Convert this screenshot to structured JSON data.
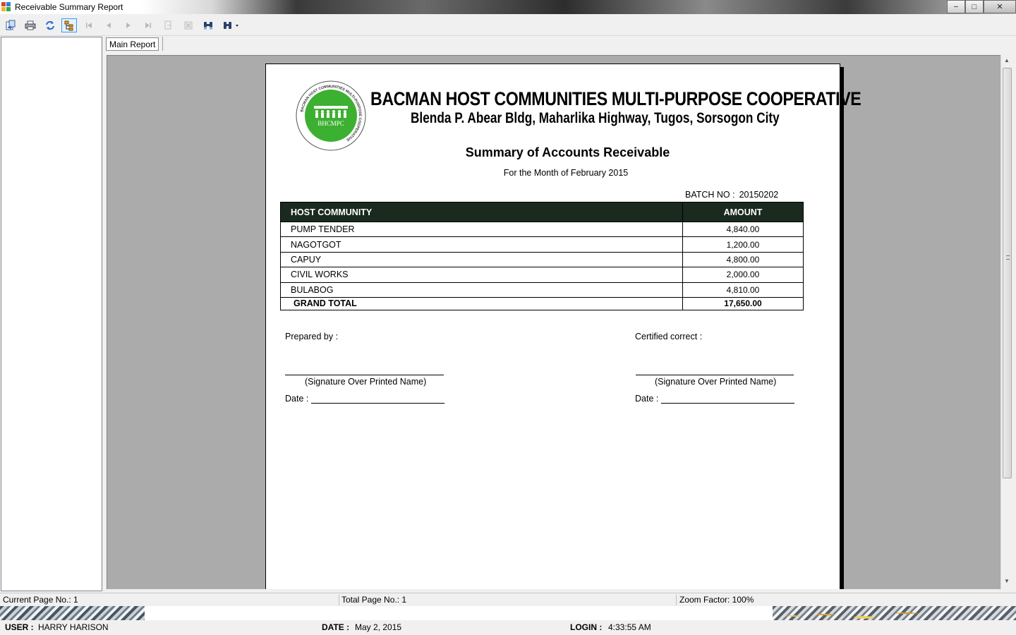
{
  "window": {
    "title": "Receivable Summary Report",
    "minimize_glyph": "−",
    "maximize_glyph": "□",
    "close_glyph": "✕"
  },
  "toolbar": {
    "buttons": [
      {
        "name": "export-icon"
      },
      {
        "name": "print-icon"
      },
      {
        "name": "refresh-icon"
      },
      {
        "name": "toggle-group-tree-icon"
      },
      {
        "name": "first-page-icon"
      },
      {
        "name": "previous-page-icon"
      },
      {
        "name": "next-page-icon"
      },
      {
        "name": "last-page-icon"
      },
      {
        "name": "goto-page-icon"
      },
      {
        "name": "stop-icon"
      },
      {
        "name": "find-icon"
      },
      {
        "name": "zoom-icon"
      }
    ]
  },
  "tabs": [
    {
      "label": "Main Report"
    }
  ],
  "report": {
    "coop_name": "BACMAN HOST COMMUNITIES MULTI-PURPOSE COOPERATIVE",
    "coop_address": "Blenda P. Abear Bldg, Maharlika Highway, Tugos, Sorsogon City",
    "seal_ring_text": "BACMAN HOST COMMUNITIES MULTI-PURPOSE COOPERATIVE",
    "seal_abbrev": "BHCMPC",
    "title": "Summary of Accounts Receivable",
    "subtitle": "For the Month of  February 2015",
    "batch_label": "BATCH NO :",
    "batch_value": "20150202",
    "table": {
      "headers": [
        "HOST COMMUNITY",
        "AMOUNT"
      ],
      "rows": [
        {
          "community": "PUMP TENDER",
          "amount": "4,840.00"
        },
        {
          "community": "NAGOTGOT",
          "amount": "1,200.00"
        },
        {
          "community": "CAPUY",
          "amount": "4,800.00"
        },
        {
          "community": "CIVIL WORKS",
          "amount": "2,000.00"
        },
        {
          "community": "BULABOG",
          "amount": "4,810.00"
        }
      ],
      "total_label": "GRAND TOTAL",
      "total_amount": "17,650.00"
    },
    "prepared_label": "Prepared by :",
    "certified_label": "Certified correct :",
    "signature_caption": "(Signature Over Printed Name)",
    "date_label": "Date :"
  },
  "status": {
    "current_page": "Current Page No.: 1",
    "total_page": "Total Page No.: 1",
    "zoom": "Zoom Factor: 100%"
  },
  "footer": {
    "user_label": "USER :",
    "user_value": "HARRY HARISON",
    "date_label": "DATE :",
    "date_value": "May 2, 2015",
    "login_label": "LOGIN :",
    "login_value": "4:33:55 AM"
  },
  "colors": {
    "table_header_bg": "#1a2a1e",
    "seal_green": "#3cb030",
    "viewer_bg": "#ababab"
  }
}
